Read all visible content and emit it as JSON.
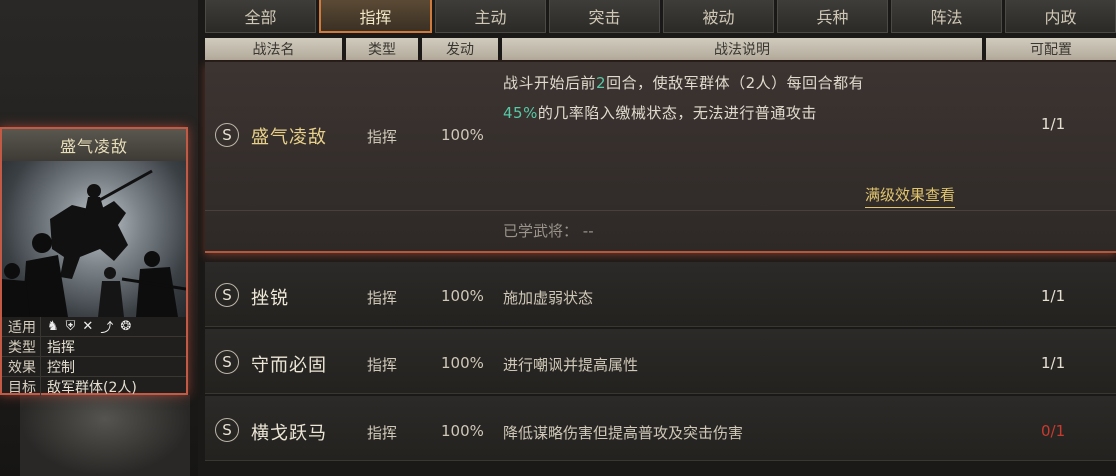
{
  "tabs": [
    "全部",
    "指挥",
    "主动",
    "突击",
    "被动",
    "兵种",
    "阵法",
    "内政"
  ],
  "active_tab": 1,
  "headers": {
    "name": "战法名",
    "type": "类型",
    "trigger": "发动",
    "desc": "战法说明",
    "config": "可配置"
  },
  "card": {
    "title": "盛气凌敌",
    "attrs": [
      {
        "key": "适用",
        "value": ""
      },
      {
        "key": "类型",
        "value": "指挥"
      },
      {
        "key": "效果",
        "value": "控制"
      },
      {
        "key": "目标",
        "value": "敌军群体(2人)"
      }
    ],
    "unit_icons": [
      "cavalry-icon",
      "shield-icon",
      "bow-icon",
      "spear-icon",
      "chariot-icon"
    ]
  },
  "skills": [
    {
      "grade": "S",
      "name": "盛气凌敌",
      "type": "指挥",
      "rate": "100%",
      "desc_line1_a": "战斗开始后前",
      "desc_line1_num": "2",
      "desc_line1_b": "回合，使敌军群体（2人）每回合都有",
      "desc_line2_pct": "45%",
      "desc_line2_b": "的几率陷入缴械状态，无法进行普通攻击",
      "config": "1/1",
      "link": "满级效果查看",
      "learned_label": "已学武将：",
      "learned_value": "--"
    },
    {
      "grade": "S",
      "name": "挫锐",
      "type": "指挥",
      "rate": "100%",
      "desc": "施加虚弱状态",
      "config": "1/1"
    },
    {
      "grade": "S",
      "name": "守而必固",
      "type": "指挥",
      "rate": "100%",
      "desc": "进行嘲讽并提高属性",
      "config": "1/1"
    },
    {
      "grade": "S",
      "name": "横戈跃马",
      "type": "指挥",
      "rate": "100%",
      "desc": "降低谋略伤害但提高普攻及突击伤害",
      "config": "0/1"
    }
  ],
  "colors": {
    "accent": "#d07a3b",
    "highlight_name": "#e8d08a",
    "percent_green": "#58c8a6",
    "config_red": "#c93a2f"
  }
}
